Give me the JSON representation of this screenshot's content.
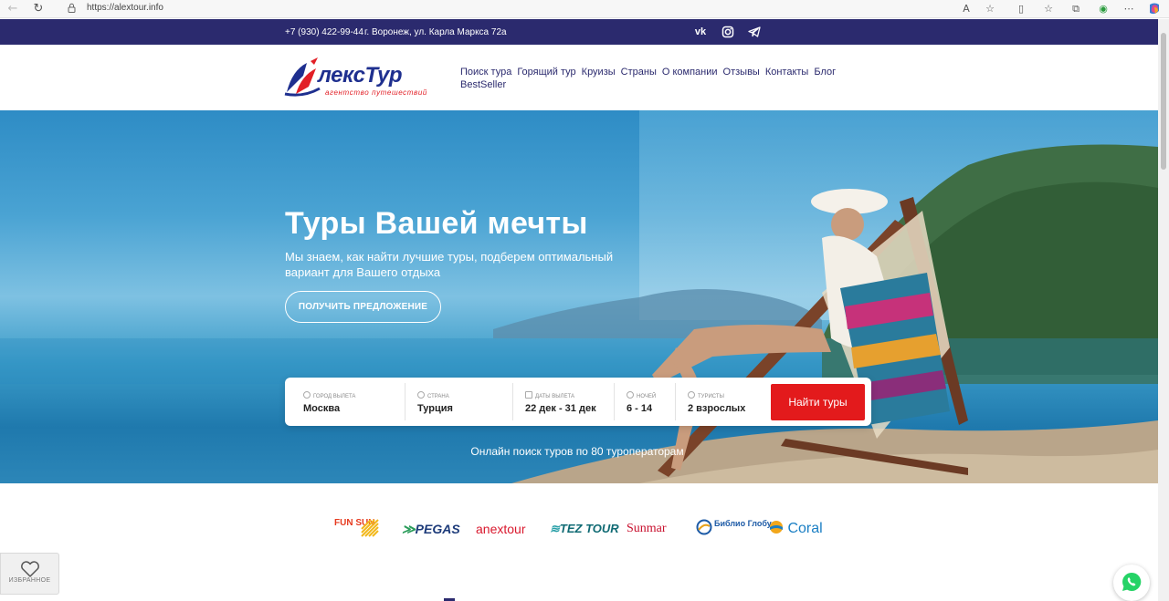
{
  "browser": {
    "url": "https://alextour.info",
    "icons": [
      "back-icon",
      "reload-icon",
      "lock-icon",
      "read-aloud-icon",
      "favorite-star-icon",
      "split-screen-icon",
      "favorites-icon",
      "collections-icon",
      "extensions-icon",
      "more-icon",
      "copilot-icon"
    ]
  },
  "topbar": {
    "phone": "+7 (930) 422-99-44",
    "address": "г. Воронеж, ул. Карла Маркса 72а",
    "social": [
      "vk-icon",
      "instagram-icon",
      "telegram-icon"
    ]
  },
  "logo": {
    "name": "лексТур",
    "tagline": "агентство путешествий"
  },
  "nav": {
    "items": [
      "Поиск тура",
      "Горящий тур",
      "Круизы",
      "Страны",
      "О компании",
      "Отзывы",
      "Контакты",
      "Блог",
      "BestSeller"
    ]
  },
  "hero": {
    "title": "Туры Вашей мечты",
    "subtitle": "Мы знаем, как найти лучшие туры, подберем оптимальный вариант для Вашего отдыха",
    "cta": "ПОЛУЧИТЬ ПРЕДЛОЖЕНИЕ",
    "caption": "Онлайн поиск туров по 80 туроператорам"
  },
  "search": {
    "fields": [
      {
        "label": "Город вылета",
        "value": "Москва"
      },
      {
        "label": "Страна",
        "value": "Турция"
      },
      {
        "label": "Даты вылета",
        "value": "22 дек - 31 дек"
      },
      {
        "label": "Ночей",
        "value": "6 - 14"
      },
      {
        "label": "Туристы",
        "value": "2 взрослых"
      }
    ],
    "button": "Найти туры"
  },
  "partners": {
    "logos": [
      "FUN SUN",
      "PEGAS",
      "anextour",
      "TEZ TOUR",
      "Sunmar",
      "Библио Глобус",
      "Coral"
    ],
    "colors": {
      "funsun": "#e63a1e",
      "pegas": "#1d3b7a",
      "anex": "#d9182d",
      "tez": "#0f6a73",
      "sunmar": "#c8102e",
      "biblio": "#1c5aa6",
      "coral": "#1b7fc4"
    }
  },
  "favorites": {
    "label": "ИЗБРАННОЕ"
  },
  "colors": {
    "navy": "#2b2a6e",
    "red": "#e31a1c",
    "hero_blue": "#3a9bc8"
  }
}
